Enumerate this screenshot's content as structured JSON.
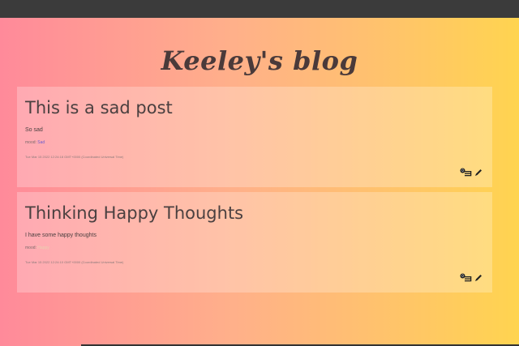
{
  "blog": {
    "title": "Keeley's blog"
  },
  "posts": [
    {
      "title": "This is a sad post",
      "body": "So sad",
      "mood_label": "mood:",
      "mood_value": "Sad",
      "date": "Tue Mar 15 2022 12:24:18 GMT+0000 (Coordinated Universal Time)",
      "comment_count": "0"
    },
    {
      "title": "Thinking Happy Thoughts",
      "body": "I have some happy thoughts",
      "mood_label": "mood:",
      "mood_value": "Happy",
      "date": "Tue Mar 15 2022 12:24:10 GMT+0000 (Coordinated Universal Time)",
      "comment_count": "0"
    }
  ],
  "icons": {
    "comment": "comment-icon",
    "edit": "pencil-icon"
  }
}
